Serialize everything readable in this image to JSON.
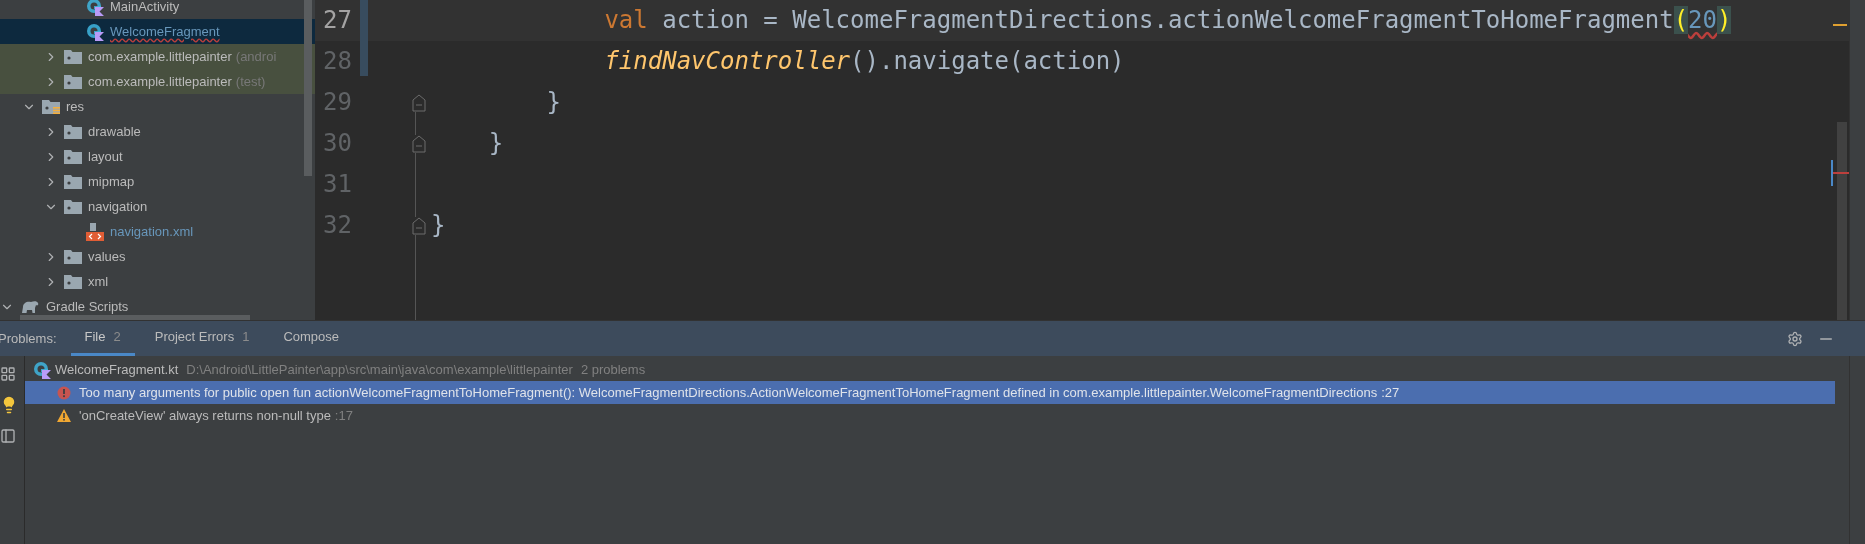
{
  "project_tree": [
    {
      "children": [
        {
          "children": [
            {
              "children": [
                {
                  "label": "MainActivity",
                  "kind": "kotlin-class",
                  "selected": false,
                  "modified": false,
                  "error": false
                },
                {
                  "label": "WelcomeFragment",
                  "kind": "kotlin-class",
                  "selected": true,
                  "modified": true,
                  "error": true
                }
              ]
            },
            {
              "label": "com.example.littlepainter",
              "note": "(androi",
              "kind": "folder",
              "expanded": false,
              "test_root": true,
              "selected": false
            },
            {
              "label": "com.example.littlepainter",
              "note": "(test)",
              "kind": "folder",
              "expanded": false,
              "test_root": true,
              "selected": false
            }
          ]
        },
        {
          "label": "res",
          "kind": "res-folder",
          "expanded": true,
          "selected": false,
          "children": [
            {
              "label": "drawable",
              "kind": "folder",
              "expanded": false,
              "selected": false
            },
            {
              "label": "layout",
              "kind": "folder",
              "expanded": false,
              "selected": false
            },
            {
              "label": "mipmap",
              "kind": "folder",
              "expanded": false,
              "selected": false
            },
            {
              "label": "navigation",
              "kind": "folder",
              "expanded": true,
              "selected": false,
              "children": [
                {
                  "label": "navigation.xml",
                  "kind": "xml-file",
                  "selected": false,
                  "modified": true,
                  "error": false
                }
              ]
            },
            {
              "label": "values",
              "kind": "folder",
              "expanded": false,
              "selected": false
            },
            {
              "label": "xml",
              "kind": "folder",
              "expanded": false,
              "selected": false
            }
          ]
        }
      ]
    },
    {
      "label": "Gradle Scripts",
      "kind": "gradle",
      "expanded": true,
      "selected": false
    }
  ],
  "editor": {
    "lines": [
      {
        "number": "27",
        "current": true,
        "fold": false,
        "tokens": [
          {
            "kind": "keyword",
            "text": "            val"
          },
          {
            "kind": "plain",
            "text": " action = WelcomeFragmentDirections.actionWelcomeFragmentToHomeFragment"
          },
          {
            "kind": "paren-match",
            "text": "("
          },
          {
            "kind": "number",
            "text": "20",
            "error": true
          },
          {
            "kind": "paren-match",
            "text": ")"
          }
        ]
      },
      {
        "number": "28",
        "current": false,
        "fold": false,
        "tokens": [
          {
            "kind": "function",
            "text": "            findNavController"
          },
          {
            "kind": "plain",
            "text": "().navigate(action)"
          }
        ]
      },
      {
        "number": "29",
        "current": false,
        "fold": true,
        "tokens": [
          {
            "kind": "plain",
            "text": "        }"
          }
        ]
      },
      {
        "number": "30",
        "current": false,
        "fold": true,
        "tokens": [
          {
            "kind": "plain",
            "text": "    }"
          }
        ]
      },
      {
        "number": "31",
        "current": false,
        "fold": false
      },
      {
        "number": "32",
        "current": false,
        "fold": true,
        "tokens": [
          {
            "kind": "plain",
            "text": "}"
          }
        ]
      }
    ]
  },
  "problems": {
    "title": "Problems:",
    "tabs": [
      {
        "label": "File",
        "count": "2",
        "selected": true
      },
      {
        "label": "Project Errors",
        "count": "1",
        "selected": false
      },
      {
        "label": "Compose",
        "selected": false
      }
    ],
    "file": {
      "name": "WelcomeFragment.kt",
      "path": "D:\\Android\\LittlePainter\\app\\src\\main\\java\\com\\example\\littlepainter",
      "summary": "2 problems"
    },
    "items": [
      {
        "kind": "error",
        "text": "Too many arguments for public open fun actionWelcomeFragmentToHomeFragment(): WelcomeFragmentDirections.ActionWelcomeFragmentToHomeFragment defined in com.example.littlepainter.WelcomeFragmentDirections",
        "line": ":27",
        "selected": true
      },
      {
        "kind": "warning",
        "text": "'onCreateView' always returns non-null type",
        "line": ":17",
        "selected": false
      }
    ]
  }
}
